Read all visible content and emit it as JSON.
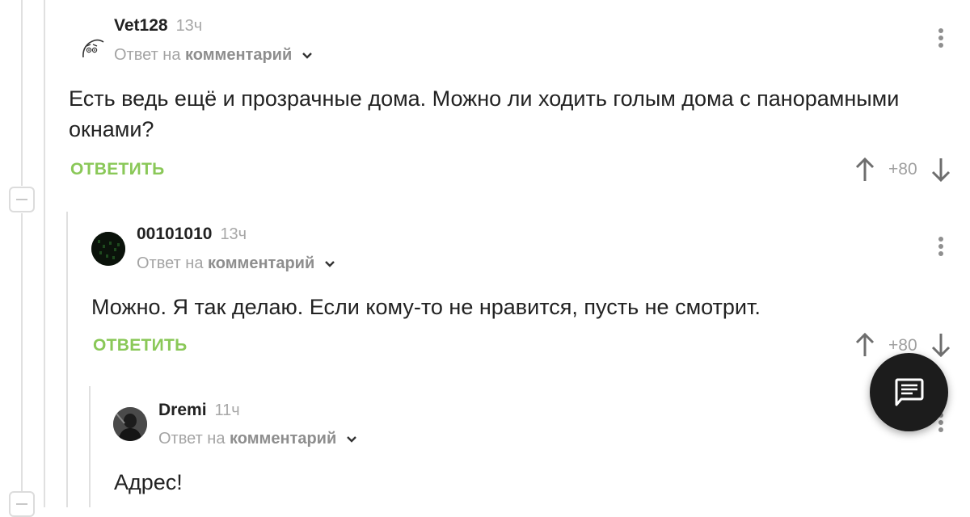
{
  "comments": [
    {
      "author": "Vet128",
      "time": "13ч",
      "reply_prefix": "Ответ на",
      "reply_target": "комментарий",
      "text": "Есть ведь ещё и прозрачные дома. Можно ли ходить голым дома с панорамными окнами?",
      "reply_label": "ОТВЕТИТЬ",
      "rating": "+80"
    },
    {
      "author": "00101010",
      "time": "13ч",
      "reply_prefix": "Ответ на",
      "reply_target": "комментарий",
      "text": "Можно. Я так делаю. Если кому-то не нравится, пусть не смотрит.",
      "reply_label": "ОТВЕТИТЬ",
      "rating": "+80"
    },
    {
      "author": "Dremi",
      "time": "11ч",
      "reply_prefix": "Ответ на",
      "reply_target": "комментарий",
      "text": "Адрес!"
    }
  ],
  "icons": {
    "upvote": "arrow-up-icon",
    "downvote": "arrow-down-icon",
    "menu": "kebab-menu-icon",
    "fab": "comment-icon"
  },
  "colors": {
    "accent": "#8ac858",
    "fab": "#1c1c1c"
  }
}
